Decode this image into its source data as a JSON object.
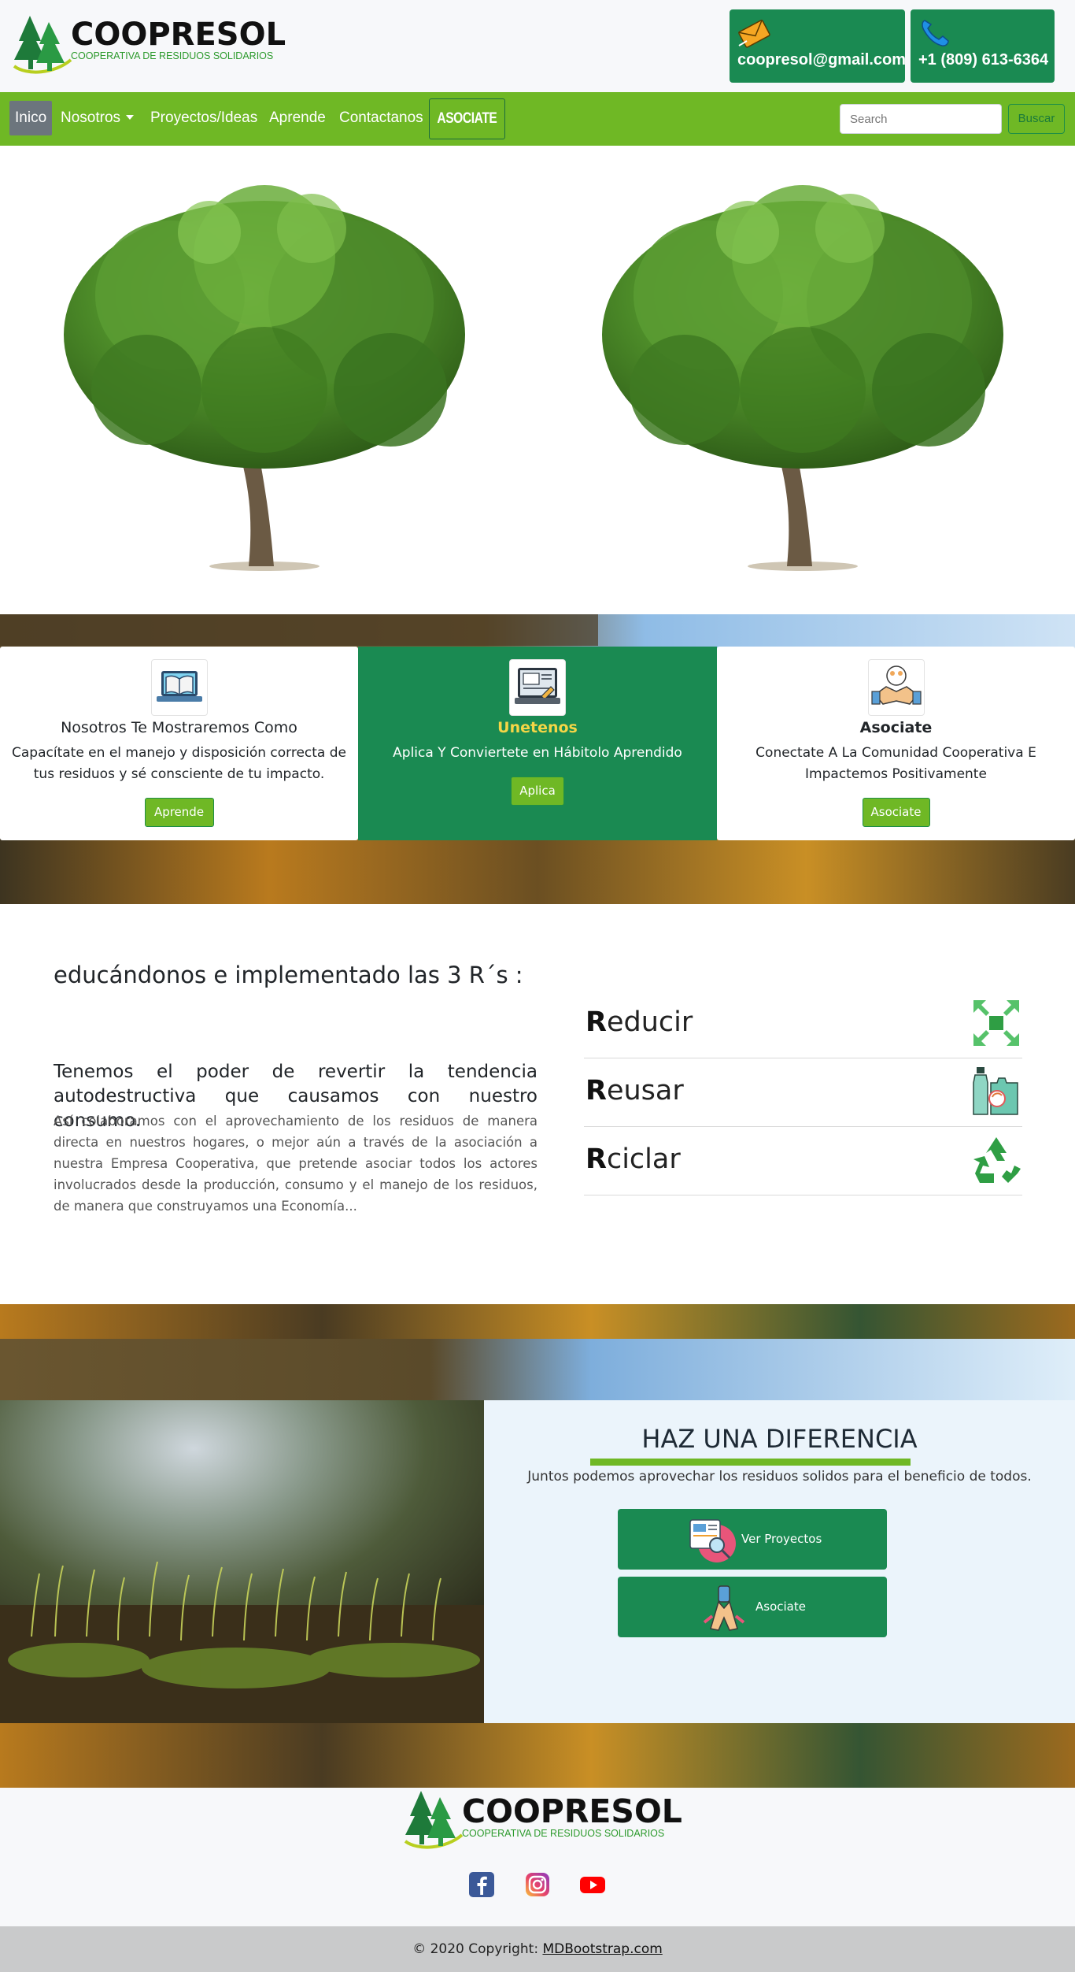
{
  "brand": {
    "name": "COOPRESOL",
    "tagline": "COOPERATIVA DE RESIDUOS SOLIDARIOS"
  },
  "header": {
    "email": "coopresol@gmail.com",
    "phone": "+1 (809) 613-6364",
    "email_icon": "envelope-icon",
    "phone_icon": "phone-icon"
  },
  "nav": {
    "items": [
      {
        "label": "Inico",
        "active": true
      },
      {
        "label": "Nosotros",
        "dropdown": true
      },
      {
        "label": "Proyectos/Ideas"
      },
      {
        "label": "Aprende"
      },
      {
        "label": "Contactanos"
      }
    ],
    "cta_label": "ASOCIATE",
    "search_placeholder": "Search",
    "search_button": "Buscar"
  },
  "cards": [
    {
      "icon": "book-laptop-icon",
      "title": "Nosotros Te Mostraremos Como",
      "text": "Capacítate en el manejo y disposición correcta de tus residuos y sé consciente de tu impacto.",
      "button": "Aprende"
    },
    {
      "icon": "online-course-icon",
      "title": "Unetenos",
      "text": "Aplica Y Conviertete en Hábitolo Aprendido",
      "button": "Aplica"
    },
    {
      "icon": "handshake-icon",
      "title": "Asociate",
      "text": "Conectate A La Comunidad Cooperativa E Impactemos Positivamente",
      "button": "Asociate"
    }
  ],
  "rsection": {
    "title": "educándonos e implementado las 3 R´s :",
    "lead_line1": "Tenemos el poder de revertir la tendencia",
    "lead_line2": "autodestructiva que causamos con nuestro consumo.",
    "body": "Así colaboramos con el aprovechamiento de los residuos de manera directa en nuestros hogares, o mejor aún a través de la asociación a nuestra Empresa Cooperativa, que pretende asociar todos los actores involucrados desde la producción, consumo y el manejo de los residuos, de manera que construyamos una Economía...",
    "items": [
      {
        "first": "R",
        "rest": "educir",
        "icon": "reduce-arrows-icon"
      },
      {
        "first": "R",
        "rest": "eusar",
        "icon": "reuse-bottles-icon"
      },
      {
        "first": "R",
        "rest": "ciclar",
        "icon": "recycle-icon"
      }
    ]
  },
  "diferencia": {
    "title": "HAZ UNA DIFERENCIA",
    "text": "Juntos podemos aprovechar los residuos solidos para el beneficio de todos.",
    "buttons": [
      {
        "label": "Ver Proyectos",
        "icon": "search-document-icon"
      },
      {
        "label": "Asociate",
        "icon": "hands-together-icon"
      }
    ]
  },
  "footer": {
    "social": [
      "facebook-icon",
      "instagram-icon",
      "youtube-icon"
    ],
    "copyright_prefix": "© 2020 Copyright:",
    "copyright_link": "MDBootstrap.com"
  },
  "colors": {
    "brand_green": "#1a8a52",
    "nav_green": "#6fb825",
    "panel_bg": "#ebf4fb"
  }
}
